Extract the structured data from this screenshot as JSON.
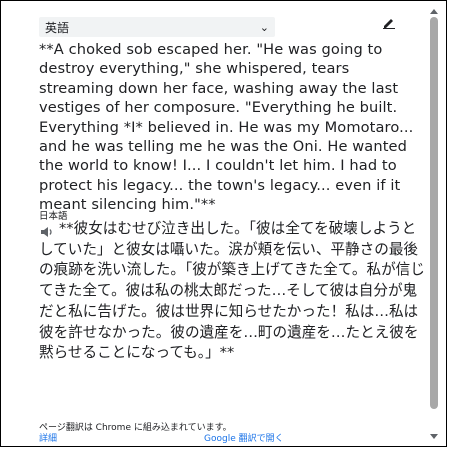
{
  "source_language": {
    "selected": "英語"
  },
  "source_text": "**A choked sob escaped her. \"He was going to destroy everything,\" she whispered, tears streaming down her face, washing away the last vestiges of her composure. \"Everything he built. Everything *I* believed in. He was my Momotaro... and he was telling me he was the Oni. He wanted the world to know! I... I couldn't let him. I had to protect his legacy... the town's legacy... even if it meant silencing him.\"**",
  "target_language": {
    "label": "日本語"
  },
  "target_text": "**彼女はむせび泣き出した。「彼は全てを破壊しようとしていた」と彼女は囁いた。涙が頬を伝い、平静さの最後の痕跡を洗い流した。「彼が築き上げてきた全て。私が信じてきた全て。彼は私の桃太郎だった…そして彼は自分が鬼だと私に告げた。彼は世界に知らせたかった！私は…私は彼を許せなかった。彼の遺産を…町の遺産を…たとえ彼を黙らせることになっても。」**",
  "footer": {
    "note": "ページ翻訳は Chrome に組み込まれています。",
    "details_link": "詳細",
    "google_link": "Google 翻訳で開く"
  },
  "icons": {
    "dropdown": "chevron-down-icon",
    "edit": "pencil-icon",
    "listen": "speaker-icon"
  }
}
